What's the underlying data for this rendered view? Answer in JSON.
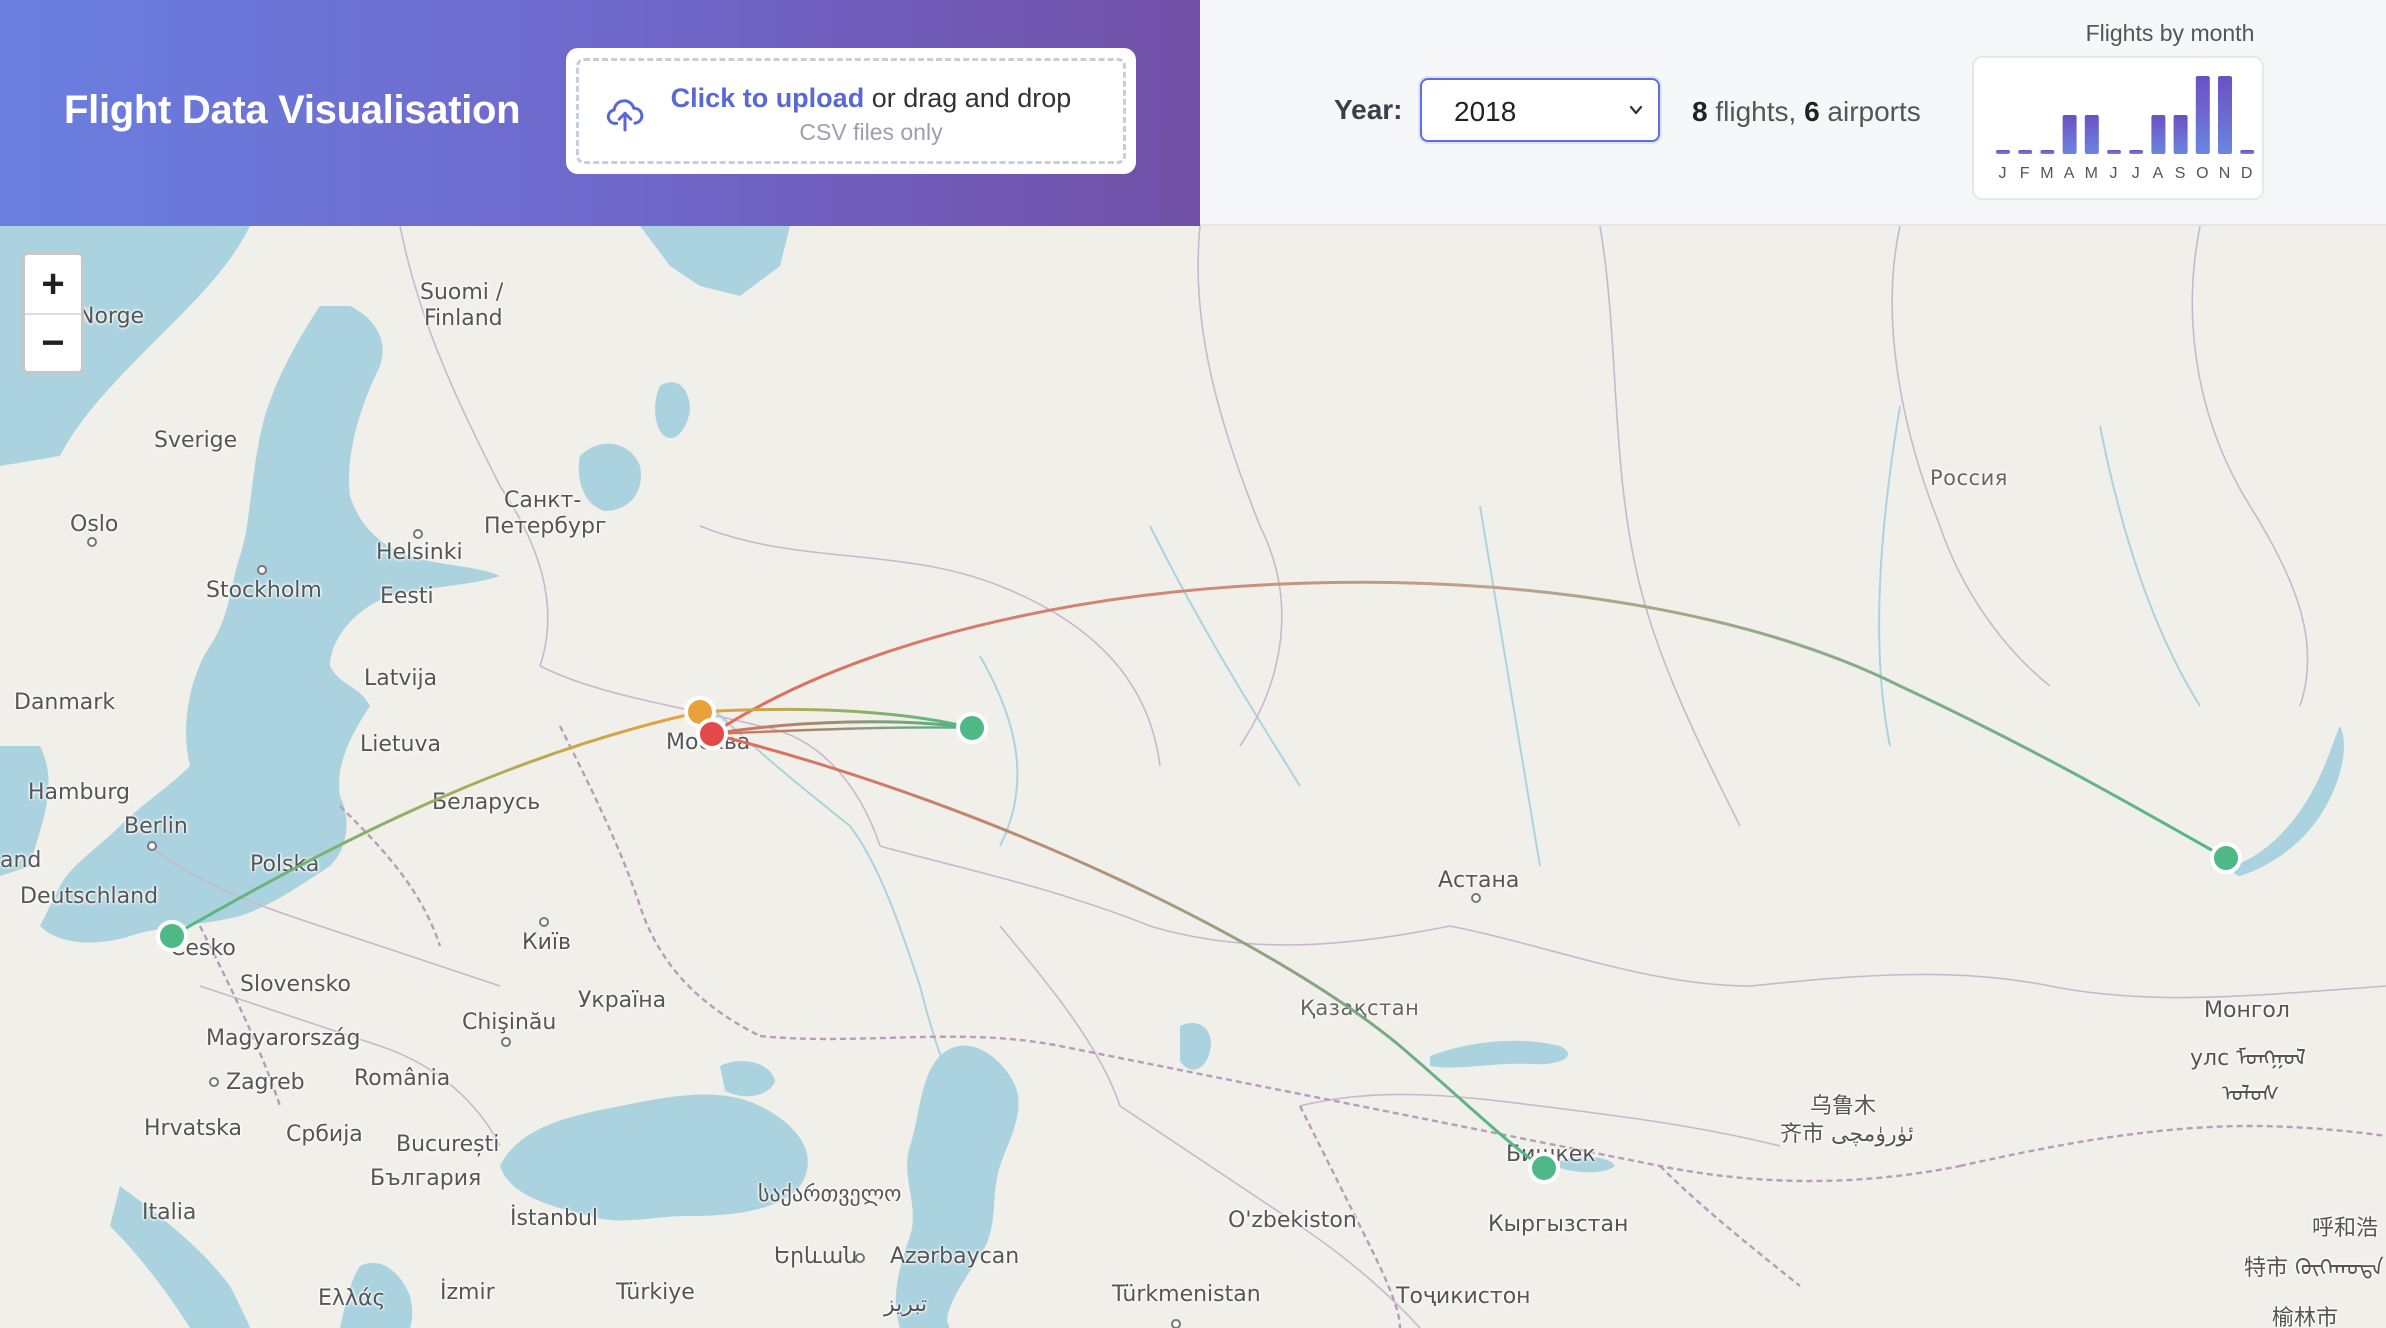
{
  "header": {
    "title": "Flight Data Visualisation",
    "upload": {
      "link_text": "Click to upload",
      "rest_text": " or drag and drop",
      "hint": "CSV files only"
    }
  },
  "controls": {
    "year_label": "Year:",
    "year_value": "2018",
    "flights_count": "8",
    "flights_word": " flights, ",
    "airports_count": "6",
    "airports_word": " airports"
  },
  "month_chart": {
    "title": "Flights by month",
    "chart_data": {
      "type": "bar",
      "title": "Flights by month",
      "categories": [
        "J",
        "F",
        "M",
        "A",
        "M",
        "J",
        "J",
        "A",
        "S",
        "O",
        "N",
        "D"
      ],
      "values": [
        0,
        0,
        0,
        1,
        1,
        0,
        0,
        1,
        1,
        2,
        2,
        0
      ],
      "ylim": [
        0,
        2
      ]
    }
  },
  "map": {
    "zoom_in": "+",
    "zoom_out": "−",
    "labels": [
      {
        "id": "norge",
        "text": "Norge"
      },
      {
        "id": "suomi",
        "text": "Suomi /"
      },
      {
        "id": "finland",
        "text": "Finland"
      },
      {
        "id": "sverige",
        "text": "Sverige"
      },
      {
        "id": "oslo",
        "text": "Oslo"
      },
      {
        "id": "helsinki",
        "text": "Helsinki"
      },
      {
        "id": "spb1",
        "text": "Санкт-"
      },
      {
        "id": "spb2",
        "text": "Петербург"
      },
      {
        "id": "stockholm",
        "text": "Stockholm"
      },
      {
        "id": "eesti",
        "text": "Eesti"
      },
      {
        "id": "latvija",
        "text": "Latvija"
      },
      {
        "id": "danmark",
        "text": "Danmark"
      },
      {
        "id": "lietuva",
        "text": "Lietuva"
      },
      {
        "id": "moskva",
        "text": "Москва"
      },
      {
        "id": "hamburg",
        "text": "Hamburg"
      },
      {
        "id": "berlin",
        "text": "Berlin"
      },
      {
        "id": "belarus",
        "text": "Беларусь"
      },
      {
        "id": "and",
        "text": "and"
      },
      {
        "id": "polska",
        "text": "Polska"
      },
      {
        "id": "deutschland",
        "text": "Deutschland"
      },
      {
        "id": "cesko",
        "text": "Česko"
      },
      {
        "id": "kyiv",
        "text": "Київ"
      },
      {
        "id": "slovensko",
        "text": "Slovensko"
      },
      {
        "id": "chisinau",
        "text": "Chişinău"
      },
      {
        "id": "ukraina",
        "text": "Україна"
      },
      {
        "id": "magyar",
        "text": "Magyarország"
      },
      {
        "id": "zagreb",
        "text": "Zagreb"
      },
      {
        "id": "romania",
        "text": "România"
      },
      {
        "id": "hrvatska",
        "text": "Hrvatska"
      },
      {
        "id": "srbija",
        "text": "Србија"
      },
      {
        "id": "bucuresti",
        "text": "București"
      },
      {
        "id": "bulgaria",
        "text": "България"
      },
      {
        "id": "italia",
        "text": "Italia"
      },
      {
        "id": "istanbul",
        "text": "İstanbul"
      },
      {
        "id": "ellas",
        "text": "Ελλάς"
      },
      {
        "id": "izmir",
        "text": "İzmir"
      },
      {
        "id": "turkiye",
        "text": "Türkiye"
      },
      {
        "id": "georgia",
        "text": "საქართველო"
      },
      {
        "id": "yerevan",
        "text": "Երևան"
      },
      {
        "id": "azerbaycan",
        "text": "Azərbaycan"
      },
      {
        "id": "tabriz",
        "text": "تبریز"
      },
      {
        "id": "rossiya",
        "text": "Россия"
      },
      {
        "id": "astana",
        "text": "Астана"
      },
      {
        "id": "kazakhstan",
        "text": "Қазақстан"
      },
      {
        "id": "bishkek",
        "text": "Бишкек"
      },
      {
        "id": "uzbekiston",
        "text": "O'zbekiston"
      },
      {
        "id": "kyrgyzstan",
        "text": "Кыргызстан"
      },
      {
        "id": "turkmenistan",
        "text": "Türkmenistan"
      },
      {
        "id": "tojikiston",
        "text": "Тоҷикистон"
      },
      {
        "id": "urumqi1",
        "text": "乌鲁木"
      },
      {
        "id": "urumqi2",
        "text": "齐市 ئۈرۈمچى"
      },
      {
        "id": "mongol1",
        "text": "Монгол"
      },
      {
        "id": "mongol2",
        "text": "улс ᠮᠣᠩᠭᠣᠯ"
      },
      {
        "id": "mongol3",
        "text": "ᠤᠯᠤᠰ"
      },
      {
        "id": "hohhot1",
        "text": "呼和浩"
      },
      {
        "id": "hohhot2",
        "text": "特市 ᠬᠦᠬᠡᠬᠣᠲᠠ"
      },
      {
        "id": "yulin",
        "text": "榆林市"
      }
    ]
  },
  "colors": {
    "header_gradient_start": "#6a7fe0",
    "header_gradient_end": "#714fa6",
    "accent": "#5968d6",
    "airport_green": "#4fb887",
    "airport_orange": "#e9a23b",
    "airport_red": "#e24a4a",
    "water": "#aad3df",
    "land": "#f1efe9"
  }
}
